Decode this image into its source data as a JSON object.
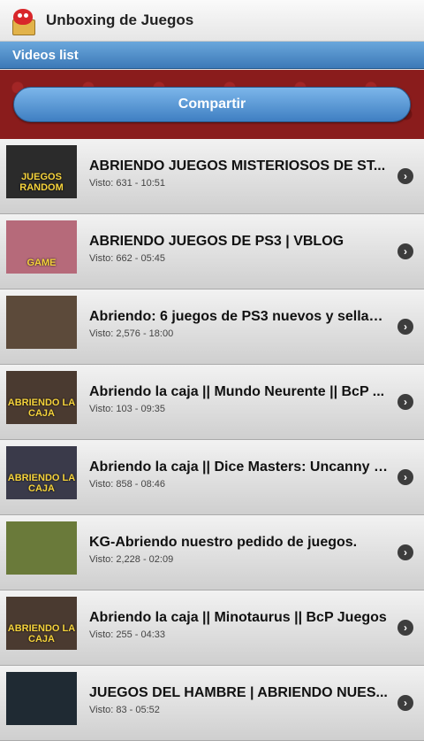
{
  "app": {
    "title": "Unboxing de Juegos",
    "icon": "monster-gift-box-icon"
  },
  "section": {
    "title": "Videos list"
  },
  "share": {
    "label": "Compartir"
  },
  "colors": {
    "header_blue": "#3c79b7",
    "share_red": "#8a1c1c",
    "chevron": "#3d3d3d"
  },
  "videos": [
    {
      "title": "ABRIENDO JUEGOS MISTERIOSOS DE ST...",
      "meta": "Visto: 631 - 10:51",
      "thumb_text": "JUEGOS RANDOM",
      "thumb_bg": "#2b2b2b"
    },
    {
      "title": "ABRIENDO JUEGOS DE PS3 | VBLOG",
      "meta": "Visto: 662 - 05:45",
      "thumb_text": "GAME",
      "thumb_bg": "#b66a7a"
    },
    {
      "title": "Abriendo: 6 juegos de PS3 nuevos y sellad...",
      "meta": "Visto: 2,576 - 18:00",
      "thumb_text": "",
      "thumb_bg": "#5c4a3a"
    },
    {
      "title": "Abriendo la caja || Mundo Neurente || BcP ...",
      "meta": "Visto: 103 - 09:35",
      "thumb_text": "ABRIENDO LA CAJA",
      "thumb_bg": "#4a3a30"
    },
    {
      "title": "Abriendo la caja || Dice Masters: Uncanny X...",
      "meta": "Visto: 858 - 08:46",
      "thumb_text": "ABRIENDO LA CAJA",
      "thumb_bg": "#3a3a4a"
    },
    {
      "title": "KG-Abriendo nuestro pedido de juegos.",
      "meta": "Visto: 2,228 - 02:09",
      "thumb_text": "",
      "thumb_bg": "#6a7a3a"
    },
    {
      "title": "Abriendo la caja || Minotaurus || BcP Juegos",
      "meta": "Visto: 255 - 04:33",
      "thumb_text": "ABRIENDO LA CAJA",
      "thumb_bg": "#4a3a30"
    },
    {
      "title": "JUEGOS DEL HAMBRE | ABRIENDO NUES...",
      "meta": "Visto: 83 - 05:52",
      "thumb_text": "",
      "thumb_bg": "#1f2a33"
    }
  ]
}
